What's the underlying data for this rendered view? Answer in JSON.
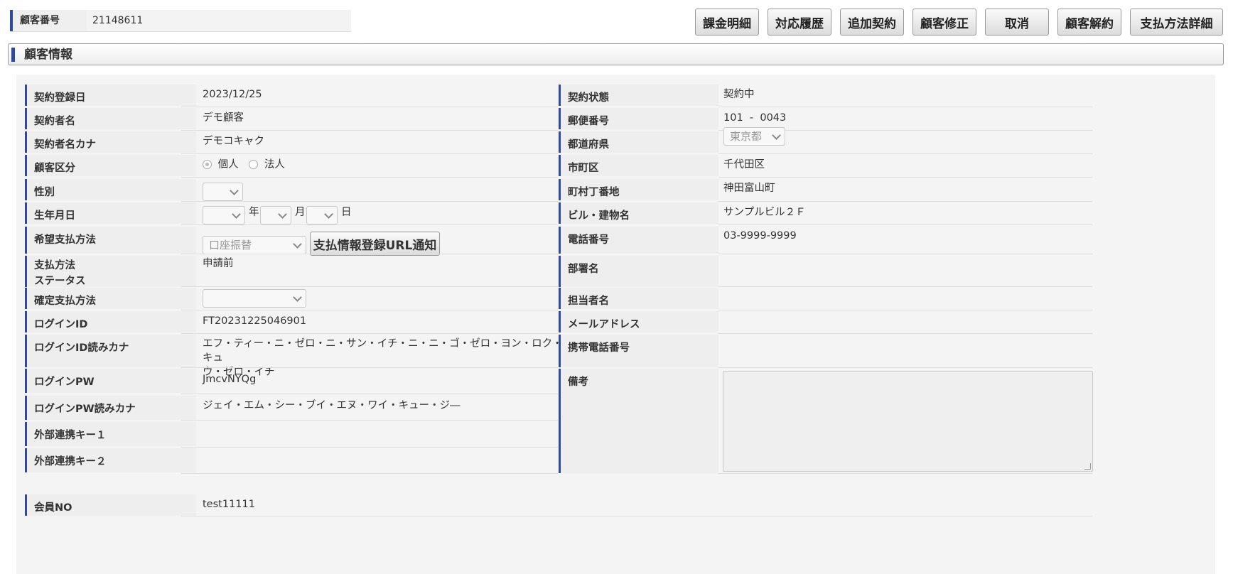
{
  "customer_no": {
    "label": "顧客番号",
    "value": "21148611"
  },
  "buttons": [
    "課金明細",
    "対応履歴",
    "追加契約",
    "顧客修正",
    "取消",
    "顧客解約",
    "支払方法詳細"
  ],
  "section_title": "顧客情報",
  "left": {
    "contract_date": {
      "label": "契約登録日",
      "value": "2023/12/25"
    },
    "contractor_name": {
      "label": "契約者名",
      "value": "デモ顧客"
    },
    "contractor_kana": {
      "label": "契約者名カナ",
      "value": "デモコキャク"
    },
    "customer_type": {
      "label": "顧客区分",
      "opt1": "個人",
      "opt2": "法人"
    },
    "gender": {
      "label": "性別"
    },
    "birthdate": {
      "label": "生年月日",
      "year": "年",
      "month": "月",
      "day": "日"
    },
    "pay_pref": {
      "label": "希望支払方法",
      "value": "口座振替",
      "button": "支払情報登録URL通知"
    },
    "pay_status": {
      "label1": "支払方法",
      "label2": "ステータス",
      "value": "申請前"
    },
    "pay_confirmed": {
      "label": "確定支払方法"
    },
    "login_id": {
      "label": "ログインID",
      "value": "FT20231225046901"
    },
    "login_id_kana": {
      "label": "ログインID読みカナ",
      "line1": "エフ・ティー・ニ・ゼロ・ニ・サン・イチ・ニ・ニ・ゴ・ゼロ・ヨン・ロク・キュ",
      "line2": "ウ・ゼロ・イチ"
    },
    "login_pw": {
      "label": "ログインPW",
      "value": "JmcvNYQg"
    },
    "login_pw_kana": {
      "label": "ログインPW読みカナ",
      "value": "ジェイ・エム・シー・ブイ・エヌ・ワイ・キュー・ジ―"
    },
    "ext_key1": {
      "label": "外部連携キー１"
    },
    "ext_key2": {
      "label": "外部連携キー２"
    },
    "member_no": {
      "label": "会員NO",
      "value": "test11111"
    }
  },
  "right": {
    "contract_status": {
      "label": "契約状態",
      "value": "契約中"
    },
    "postal": {
      "label": "郵便番号",
      "value": "101  -  0043"
    },
    "prefecture": {
      "label": "都道府県",
      "value": "東京都"
    },
    "city": {
      "label": "市町区",
      "value": "千代田区"
    },
    "address": {
      "label": "町村丁番地",
      "value": "神田富山町"
    },
    "building": {
      "label": "ビル・建物名",
      "value": "サンプルビル２Ｆ"
    },
    "phone": {
      "label": "電話番号",
      "value": "03-9999-9999"
    },
    "department": {
      "label": "部署名"
    },
    "person": {
      "label": "担当者名"
    },
    "email": {
      "label": "メールアドレス"
    },
    "mobile": {
      "label": "携帯電話番号"
    },
    "notes": {
      "label": "備考"
    }
  }
}
